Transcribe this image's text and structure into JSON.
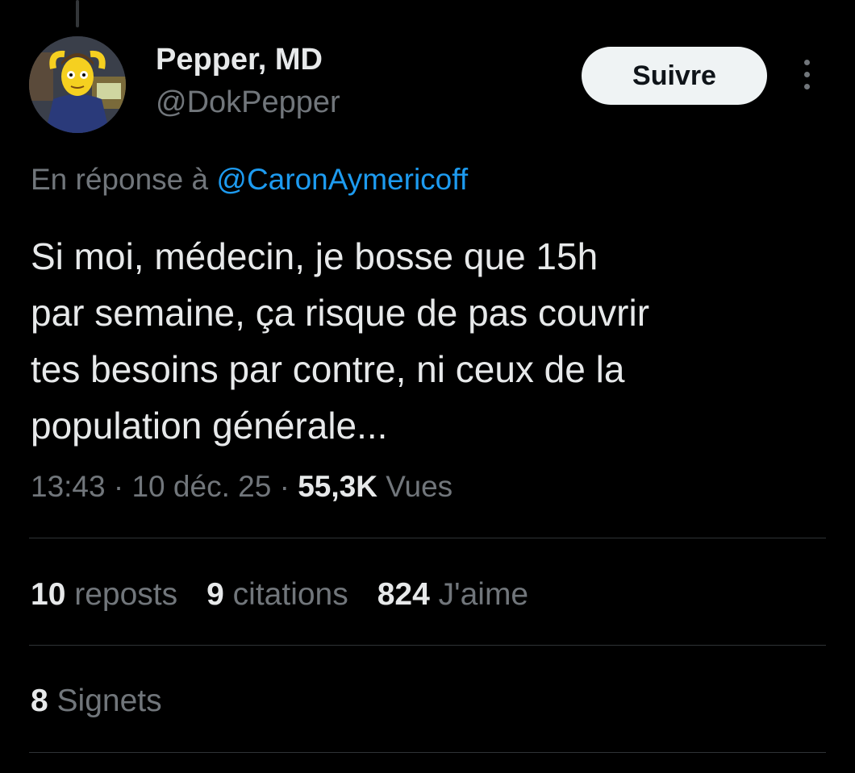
{
  "author": {
    "display_name": "Pepper, MD",
    "handle": "@DokPepper",
    "avatar_icon": "cartoon-avatar-icon"
  },
  "actions": {
    "follow_label": "Suivre",
    "more_icon": "more-options-icon"
  },
  "reply": {
    "prefix": "En réponse à ",
    "mention": "@CaronAymericoff"
  },
  "tweet": {
    "lines": [
      "Si moi, médecin, je bosse que 15h",
      "par semaine, ça risque de pas couvrir",
      "tes besoins par contre, ni ceux de la",
      "population générale..."
    ]
  },
  "meta": {
    "time": "13:43",
    "separator": " · ",
    "date": "10 déc. 25",
    "views_count": "55,3K",
    "views_label": " Vues"
  },
  "stats": {
    "reposts_count": "10",
    "reposts_label": " reposts",
    "quotes_count": "9",
    "quotes_label": " citations",
    "likes_count": "824",
    "likes_label": " J'aime",
    "bookmarks_count": "8",
    "bookmarks_label": " Signets"
  },
  "colors": {
    "background": "#000000",
    "text_primary": "#e7e9ea",
    "text_secondary": "#71767b",
    "link": "#1d9bf0",
    "divider": "#2f3336",
    "button_bg": "#eff3f4"
  }
}
